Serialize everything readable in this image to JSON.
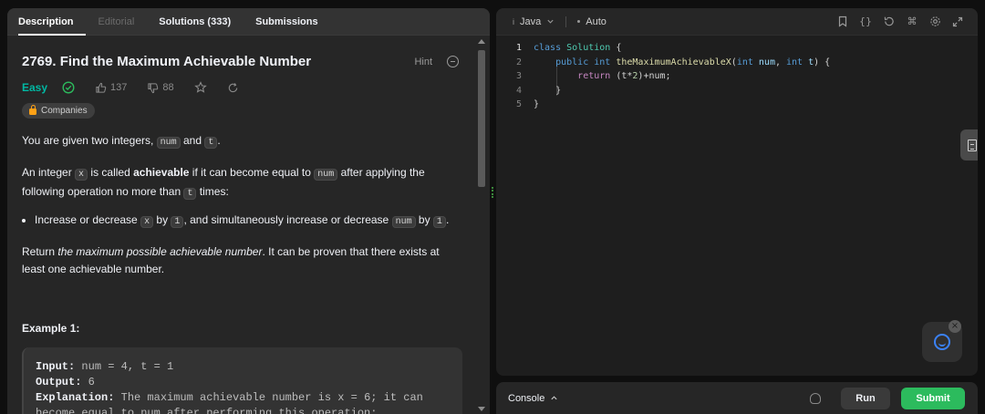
{
  "tabs": [
    {
      "label": "Description"
    },
    {
      "label": "Editorial"
    },
    {
      "label": "Solutions (333)"
    },
    {
      "label": "Submissions"
    }
  ],
  "problem": {
    "title": "2769. Find the Maximum Achievable Number",
    "hint_label": "Hint",
    "difficulty": "Easy",
    "likes": "137",
    "dislikes": "88",
    "companies_label": "Companies"
  },
  "description": {
    "p1_a": "You are given two integers, ",
    "p1_code1": "num",
    "p1_b": " and ",
    "p1_code2": "t",
    "p1_c": ".",
    "p2_a": "An integer ",
    "p2_code1": "x",
    "p2_b": " is called ",
    "p2_bold": "achievable",
    "p2_c": " if it can become equal to ",
    "p2_code2": "num",
    "p2_d": " after applying the following operation no more than ",
    "p2_code3": "t",
    "p2_e": " times:",
    "bullet_a": "Increase or decrease ",
    "bullet_code1": "x",
    "bullet_b": " by ",
    "bullet_code2": "1",
    "bullet_c": ", and simultaneously increase or decrease ",
    "bullet_code3": "num",
    "bullet_d": " by ",
    "bullet_code4": "1",
    "bullet_e": ".",
    "p3_a": "Return ",
    "p3_italic": "the maximum possible achievable number",
    "p3_b": ". It can be proven that there exists at least one achievable number."
  },
  "example": {
    "title": "Example 1:",
    "input_label": "Input:",
    "input_value": " num = 4, t = 1",
    "output_label": "Output:",
    "output_value": " 6",
    "explanation_label": "Explanation:",
    "explanation_value": " The maximum achievable number is x = 6; it can",
    "explanation_cont": "become equal to num after performing this operation:"
  },
  "editor": {
    "language": "Java",
    "mode": "Auto",
    "line_numbers": [
      "1",
      "2",
      "3",
      "4",
      "5"
    ]
  },
  "console": {
    "label": "Console",
    "run_label": "Run",
    "submit_label": "Submit"
  },
  "colors": {
    "easy": "#00b8a3",
    "submit": "#2cbb5d",
    "companies_lock": "#ffa116",
    "chat_accent": "#3b82f6"
  }
}
